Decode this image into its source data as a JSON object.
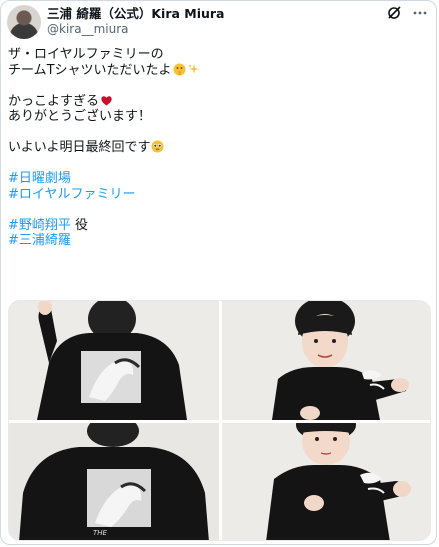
{
  "post": {
    "display_name": "三浦 綺羅（公式）Kira Miura",
    "handle": "@kira__miura",
    "lines": [
      "ザ・ロイヤルファミリーの",
      "チームTシャツいただいたよ"
    ],
    "line3": "かっこよすぎる",
    "line4": "ありがとうございます！",
    "line5": "いよいよ明日最終回です",
    "hashtags": [
      "#日曜劇場",
      "#ロイヤルファミリー"
    ],
    "hashtag_role": "#野崎翔平",
    "role_suffix": " 役",
    "hashtag_name": "#三浦綺羅"
  },
  "icons": {
    "header": [
      "grok-icon",
      "more-icon"
    ],
    "emojis": [
      "shushing-face-emoji",
      "sparkles-emoji",
      "red-heart-emoji",
      "pleading-face-emoji"
    ]
  },
  "media": {
    "photos": [
      {
        "name": "back-of-sweatshirt-photo-1"
      },
      {
        "name": "front-of-sweatshirt-photo-1"
      },
      {
        "name": "back-of-sweatshirt-photo-2"
      },
      {
        "name": "front-of-sweatshirt-photo-2"
      }
    ]
  },
  "colors": {
    "link": "#1d9bf0",
    "secondary_text": "#536471",
    "border": "#cfd9de",
    "sweatshirt": "#141414"
  }
}
